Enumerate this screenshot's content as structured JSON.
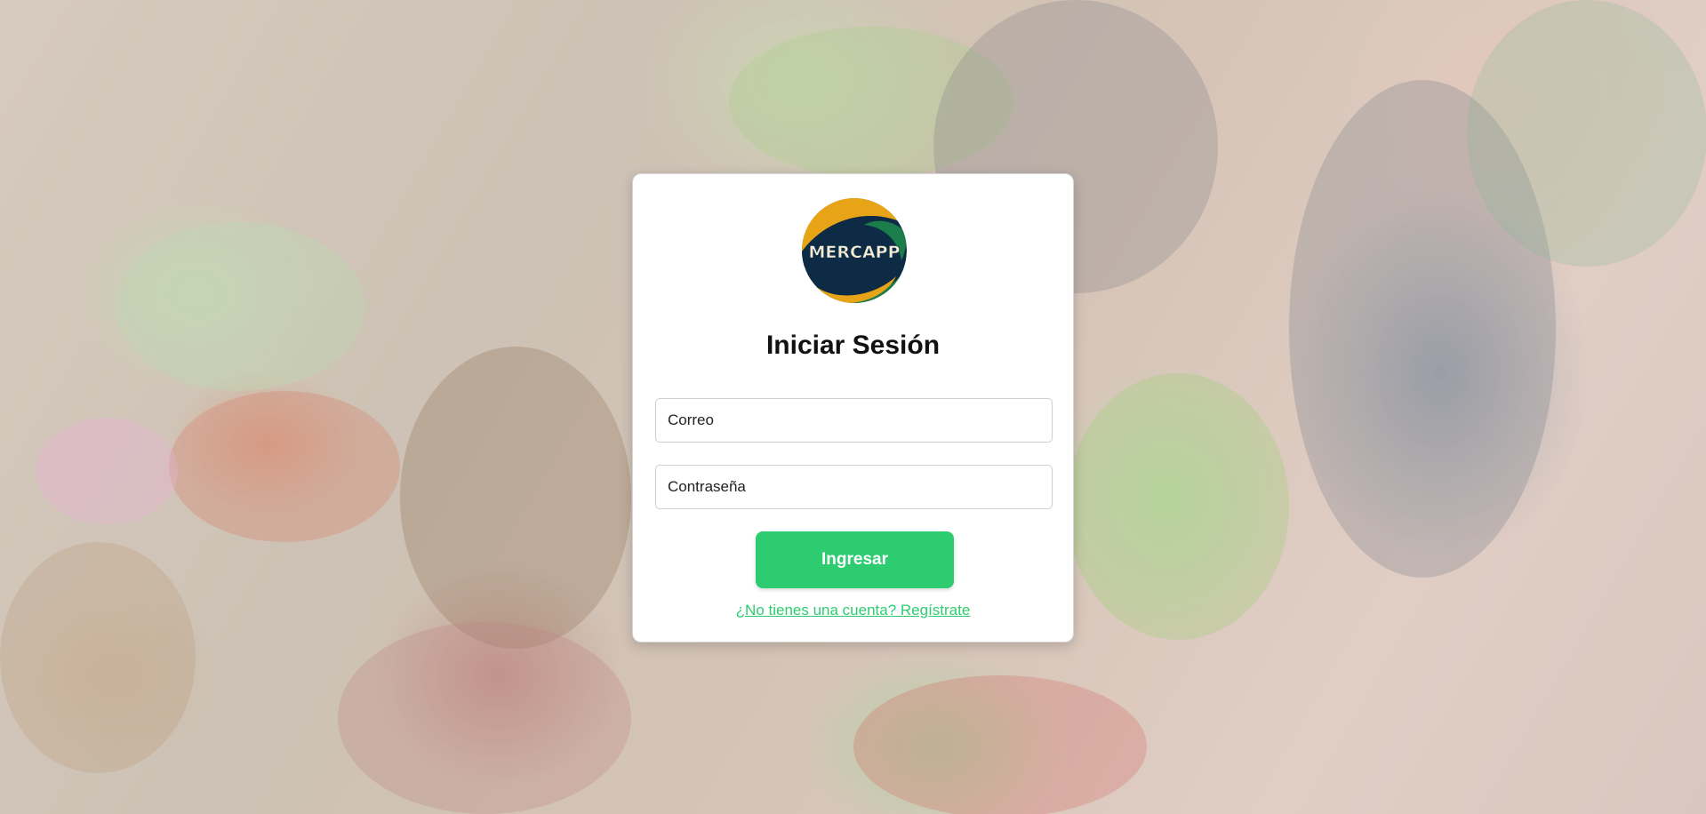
{
  "brand": {
    "logo_text": "MERCAPP",
    "colors": {
      "accent_green": "#2ecc71",
      "logo_yellow": "#e8a417",
      "logo_dark": "#0e2b45",
      "logo_green": "#1a7d4a"
    }
  },
  "login": {
    "title": "Iniciar Sesión",
    "email_placeholder": "Correo",
    "password_placeholder": "Contraseña",
    "submit_label": "Ingresar",
    "register_link": "¿No tienes una cuenta? Regístrate"
  },
  "background": {
    "icon": "market-photo"
  }
}
